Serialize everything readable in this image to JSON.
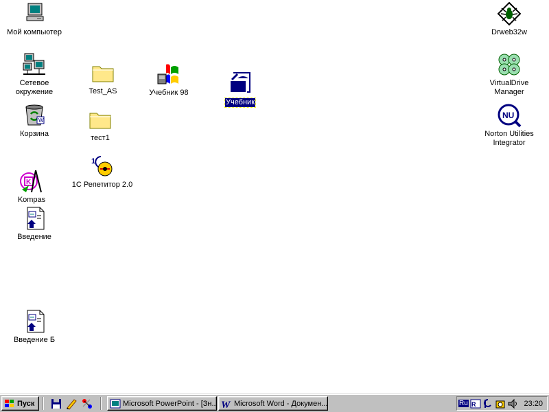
{
  "desktop": {
    "icons": {
      "my_computer": {
        "label": "Мой компьютер"
      },
      "network": {
        "label": "Сетевое\nокружение"
      },
      "recycle_bin": {
        "label": "Корзина"
      },
      "kompas": {
        "label": "Kompas"
      },
      "vvedenie": {
        "label": "Введение"
      },
      "vvedenie_b": {
        "label": "Введение Б"
      },
      "test_as": {
        "label": "Test_AS"
      },
      "test1": {
        "label": "тест1"
      },
      "repetitor": {
        "label": "1С Репетитор 2.0"
      },
      "uchebnik98": {
        "label": "Учебник 98"
      },
      "uchebnik": {
        "label": "Учебник"
      },
      "drweb": {
        "label": "Drweb32w"
      },
      "virtualdrive": {
        "label": "VirtualDrive\nManager"
      },
      "norton": {
        "label": "Norton Utilities\nIntegrator"
      }
    }
  },
  "taskbar": {
    "start_label": "Пуск",
    "tasks": [
      {
        "label": "Microsoft PowerPoint - [Зн..."
      },
      {
        "label": "Microsoft Word - Докумен..."
      }
    ],
    "tray": {
      "language": "Ru",
      "clock": "23:20"
    }
  },
  "colors": {
    "desktop": "#ffffff",
    "taskbar": "#c0c0c0",
    "selection": "#000080"
  }
}
